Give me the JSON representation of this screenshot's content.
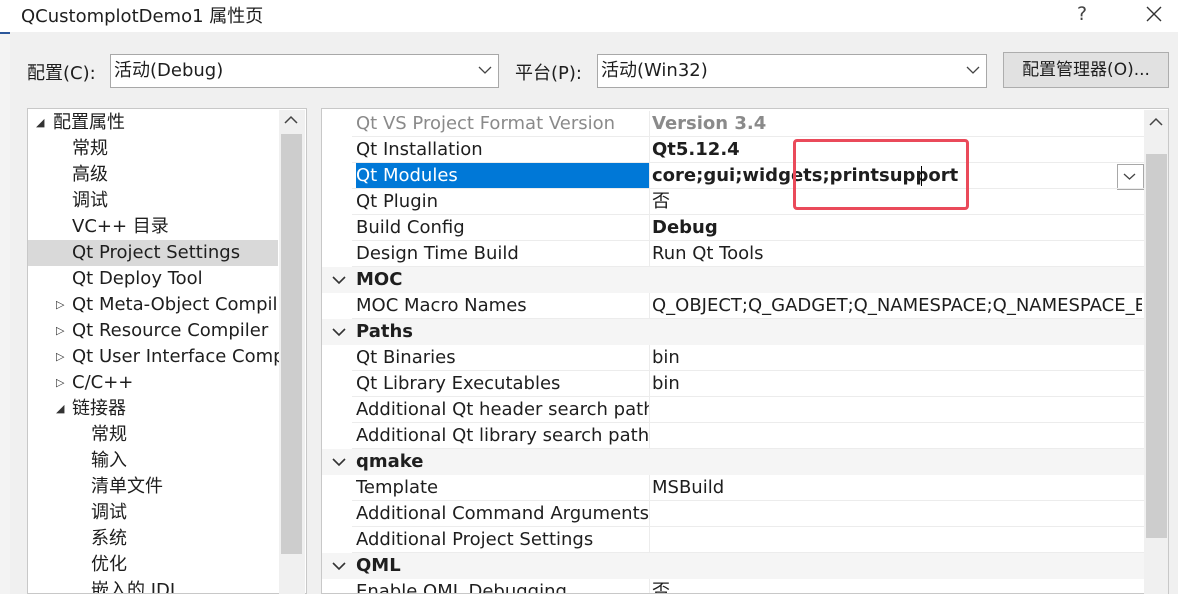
{
  "window": {
    "title": "QCustomplotDemo1 属性页",
    "help_label": "?"
  },
  "toolbar": {
    "config_label": "配置(C):",
    "config_value": "活动(Debug)",
    "platform_label": "平台(P):",
    "platform_value": "活动(Win32)",
    "config_manager_label": "配置管理器(O)..."
  },
  "tree": {
    "root": "配置属性",
    "items": [
      "常规",
      "高级",
      "调试",
      "VC++ 目录",
      "Qt Project Settings",
      "Qt Deploy Tool",
      "Qt Meta-Object Compil",
      "Qt Resource Compiler",
      "Qt User Interface Compi",
      "C/C++",
      "链接器",
      "常规",
      "输入",
      "清单文件",
      "调试",
      "系统",
      "优化",
      "嵌入的 IDL"
    ],
    "selected": "Qt Project Settings"
  },
  "grid": {
    "rows": [
      {
        "name": "Qt VS Project Format Version",
        "value": "Version 3.4"
      },
      {
        "name": "Qt Installation",
        "value": "Qt5.12.4"
      },
      {
        "name": "Qt Modules",
        "value": "core;gui;widgets;printsupport"
      },
      {
        "name": "Qt Plugin",
        "value": "否"
      },
      {
        "name": "Build Config",
        "value": "Debug"
      },
      {
        "name": "Design Time Build",
        "value": "Run Qt Tools"
      },
      {
        "category": "MOC"
      },
      {
        "name": "MOC Macro Names",
        "value": "Q_OBJECT;Q_GADGET;Q_NAMESPACE;Q_NAMESPACE_EXPORT"
      },
      {
        "category": "Paths"
      },
      {
        "name": "Qt Binaries",
        "value": "bin"
      },
      {
        "name": "Qt Library Executables",
        "value": "bin"
      },
      {
        "name": "Additional Qt header search paths",
        "value": ""
      },
      {
        "name": "Additional Qt library search paths",
        "value": ""
      },
      {
        "category": "qmake"
      },
      {
        "name": "Template",
        "value": "MSBuild"
      },
      {
        "name": "Additional Command Arguments",
        "value": ""
      },
      {
        "name": "Additional Project Settings",
        "value": ""
      },
      {
        "category": "QML"
      },
      {
        "name": "Enable QML Debugging",
        "value": "否"
      }
    ],
    "selected": "Qt Modules"
  },
  "colors": {
    "selection": "#0078d7",
    "annotation_box": "#ea4a5a",
    "tree_selection": "#d9d9d9"
  },
  "icons": [
    "help-icon",
    "close-icon",
    "chevron-down-icon",
    "expand-triangle-icon",
    "collapse-triangle-icon",
    "scroll-up-icon"
  ]
}
